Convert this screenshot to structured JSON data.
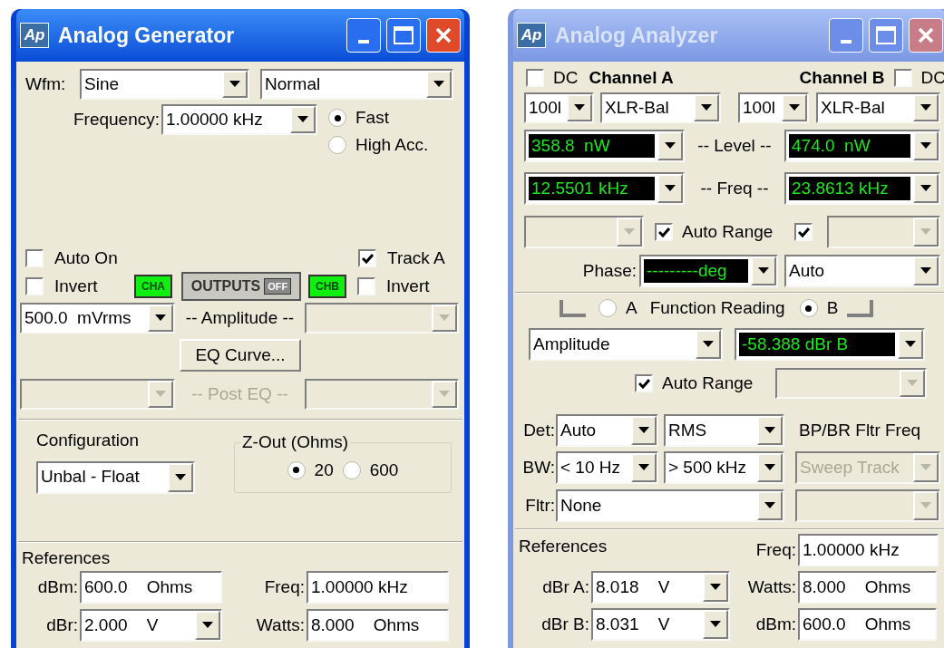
{
  "generator": {
    "title": "Analog Generator",
    "logo": "Ap",
    "active": true,
    "waveform": {
      "label": "Wfm:",
      "type": {
        "value": "Sine"
      },
      "mode": {
        "value": "Normal"
      }
    },
    "frequency": {
      "label": "Frequency:",
      "combo": {
        "value": "1.00000 kHz"
      },
      "options": [
        {
          "label": "Fast",
          "selected": true
        },
        {
          "label": "High Acc.",
          "selected": false
        }
      ]
    },
    "auto_on": {
      "label": "Auto On",
      "checked": false
    },
    "track_a": {
      "label": "Track A",
      "checked": true
    },
    "invert_a": {
      "label": "Invert",
      "checked": false
    },
    "cha": {
      "label": "CHA",
      "on": true
    },
    "outputs": {
      "label": "OUTPUTS",
      "indicator": "OFF"
    },
    "chb": {
      "label": "CHB",
      "on": true
    },
    "invert_b": {
      "label": "Invert",
      "checked": false
    },
    "amplitude": {
      "label": "-- Amplitude --",
      "disabled": false,
      "a": {
        "value": "500.0  mVrms"
      },
      "b": {
        "disabled": true
      }
    },
    "eq_button": "EQ Curve...",
    "post_eq": {
      "label": "-- Post EQ --",
      "disabled": true,
      "a": {
        "disabled": true
      },
      "b": {
        "disabled": true
      }
    },
    "configuration": {
      "label": "Configuration",
      "combo": {
        "value": "Unbal - Float"
      }
    },
    "z_out": {
      "label": "Z-Out (Ohms)",
      "options": [
        {
          "label": "20",
          "selected": true
        },
        {
          "label": "600",
          "selected": false
        }
      ]
    },
    "references": {
      "label": "References",
      "rows": [
        [
          {
            "label": "dBm:",
            "value": "600.0    Ohms",
            "kind": "field"
          },
          {
            "label": "Freq:",
            "value": "1.00000 kHz",
            "kind": "field"
          }
        ],
        [
          {
            "label": "dBr:",
            "value": "2.000    V",
            "kind": "combo"
          },
          {
            "label": "Watts:",
            "value": "8.000    Ohms",
            "kind": "field"
          }
        ]
      ]
    }
  },
  "analyzer": {
    "title": "Analog Analyzer",
    "logo": "Ap",
    "active": false,
    "channels": [
      {
        "name": "Channel A",
        "dc": {
          "label": "DC",
          "checked": false
        },
        "range": {
          "value": "100l"
        },
        "input": {
          "value": "XLR-Bal"
        },
        "level": {
          "value": "358.8  nW",
          "readout": true
        },
        "freq": {
          "value": "12.5501 kHz",
          "readout": true
        },
        "range_select": {
          "disabled": true
        },
        "auto_range": {
          "checked": true
        }
      },
      {
        "name": "Channel B",
        "dc": {
          "label": "DC",
          "checked": false
        },
        "range": {
          "value": "100l"
        },
        "input": {
          "value": "XLR-Bal"
        },
        "level": {
          "value": "474.0  nW",
          "readout": true
        },
        "freq": {
          "value": "23.8613 kHz",
          "readout": true
        },
        "range_select": {
          "disabled": true
        },
        "auto_range": {
          "checked": true
        }
      }
    ],
    "level_label": "-- Level --",
    "freq_label": "-- Freq --",
    "auto_range_label": "Auto Range",
    "phase": {
      "label": "Phase:",
      "reading": {
        "value": "---------deg",
        "readout": true
      },
      "mode": {
        "value": "Auto"
      }
    },
    "function_reading": {
      "label": "Function Reading",
      "channels": [
        {
          "label": "A",
          "selected": false
        },
        {
          "label": "B",
          "selected": true
        }
      ],
      "function": {
        "value": "Amplitude"
      },
      "reading": {
        "value": "-58.388 dBr B",
        "readout": true
      },
      "auto_range": {
        "label": "Auto Range",
        "checked": true
      },
      "range": {
        "disabled": true
      }
    },
    "detector": {
      "label": "Det:",
      "a": {
        "value": "Auto"
      },
      "b": {
        "value": "RMS"
      }
    },
    "bandwidth": {
      "label": "BW:",
      "a": {
        "value": "< 10 Hz"
      },
      "b": {
        "value": "> 500 kHz"
      }
    },
    "filter": {
      "label": "Fltr:",
      "combo": {
        "value": "None"
      }
    },
    "bp_br": {
      "label": "BP/BR Fltr Freq",
      "mode": {
        "value": "Sweep Track",
        "disabled": true
      },
      "freq": {
        "disabled": true
      }
    },
    "references": {
      "rows": [
        [
          {
            "label": "References",
            "kind": "heading"
          },
          {
            "label": "Freq:",
            "value": "1.00000 kHz",
            "kind": "field"
          }
        ],
        [
          {
            "label": "dBr A:",
            "value": "8.018    V",
            "kind": "combo"
          },
          {
            "label": "Watts:",
            "value": "8.000    Ohms",
            "kind": "field"
          }
        ],
        [
          {
            "label": "dBr B:",
            "value": "8.031    V",
            "kind": "combo"
          },
          {
            "label": "dBm:",
            "value": "600.0    Ohms",
            "kind": "field"
          }
        ]
      ]
    }
  }
}
